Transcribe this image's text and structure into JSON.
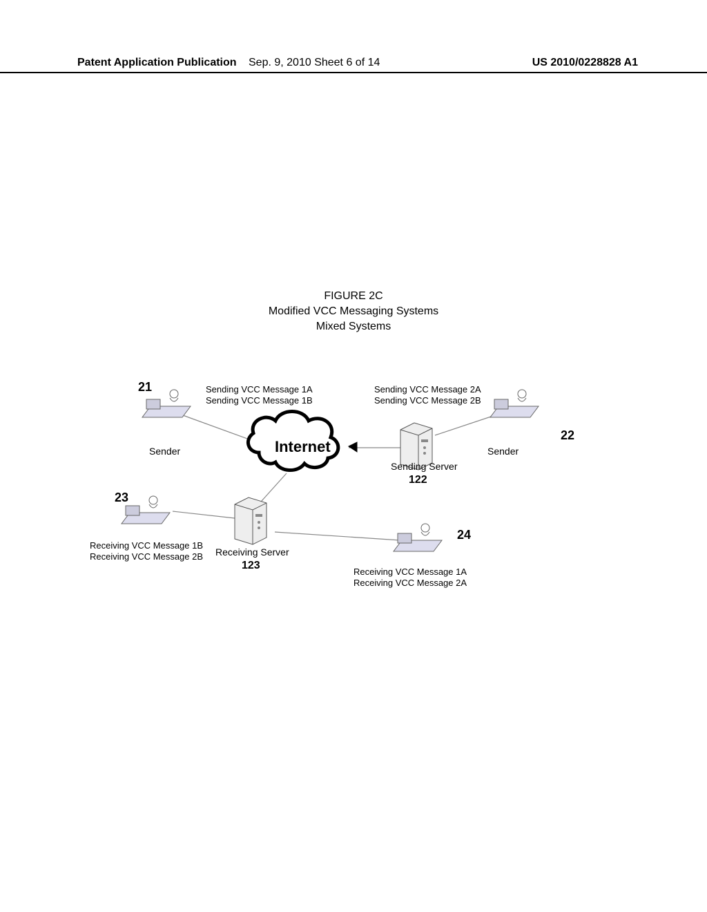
{
  "header": {
    "left": "Patent Application Publication",
    "center": "Sep. 9, 2010  Sheet 6 of 14",
    "right": "US 2010/0228828 A1"
  },
  "title": {
    "line1": "FIGURE 2C",
    "line2": "Modified VCC Messaging Systems",
    "line3": "Mixed Systems"
  },
  "diagram": {
    "internet_label": "Internet",
    "nodes": {
      "sender21": {
        "ref": "21",
        "role": "Sender",
        "messages": [
          "Sending VCC Message 1A",
          "Sending VCC Message 1B"
        ]
      },
      "sender22": {
        "ref": "22",
        "role": "Sender",
        "messages": [
          "Sending VCC Message 2A",
          "Sending VCC Message 2B"
        ]
      },
      "sending_server": {
        "ref": "122",
        "role": "Sending Server"
      },
      "receiving_server": {
        "ref": "123",
        "role": "Receiving Server"
      },
      "receiver23": {
        "ref": "23",
        "messages": [
          "Receiving VCC Message 1B",
          "Receiving VCC Message 2B"
        ]
      },
      "receiver24": {
        "ref": "24",
        "messages": [
          "Receiving VCC Message 1A",
          "Receiving VCC Message 2A"
        ]
      }
    }
  }
}
